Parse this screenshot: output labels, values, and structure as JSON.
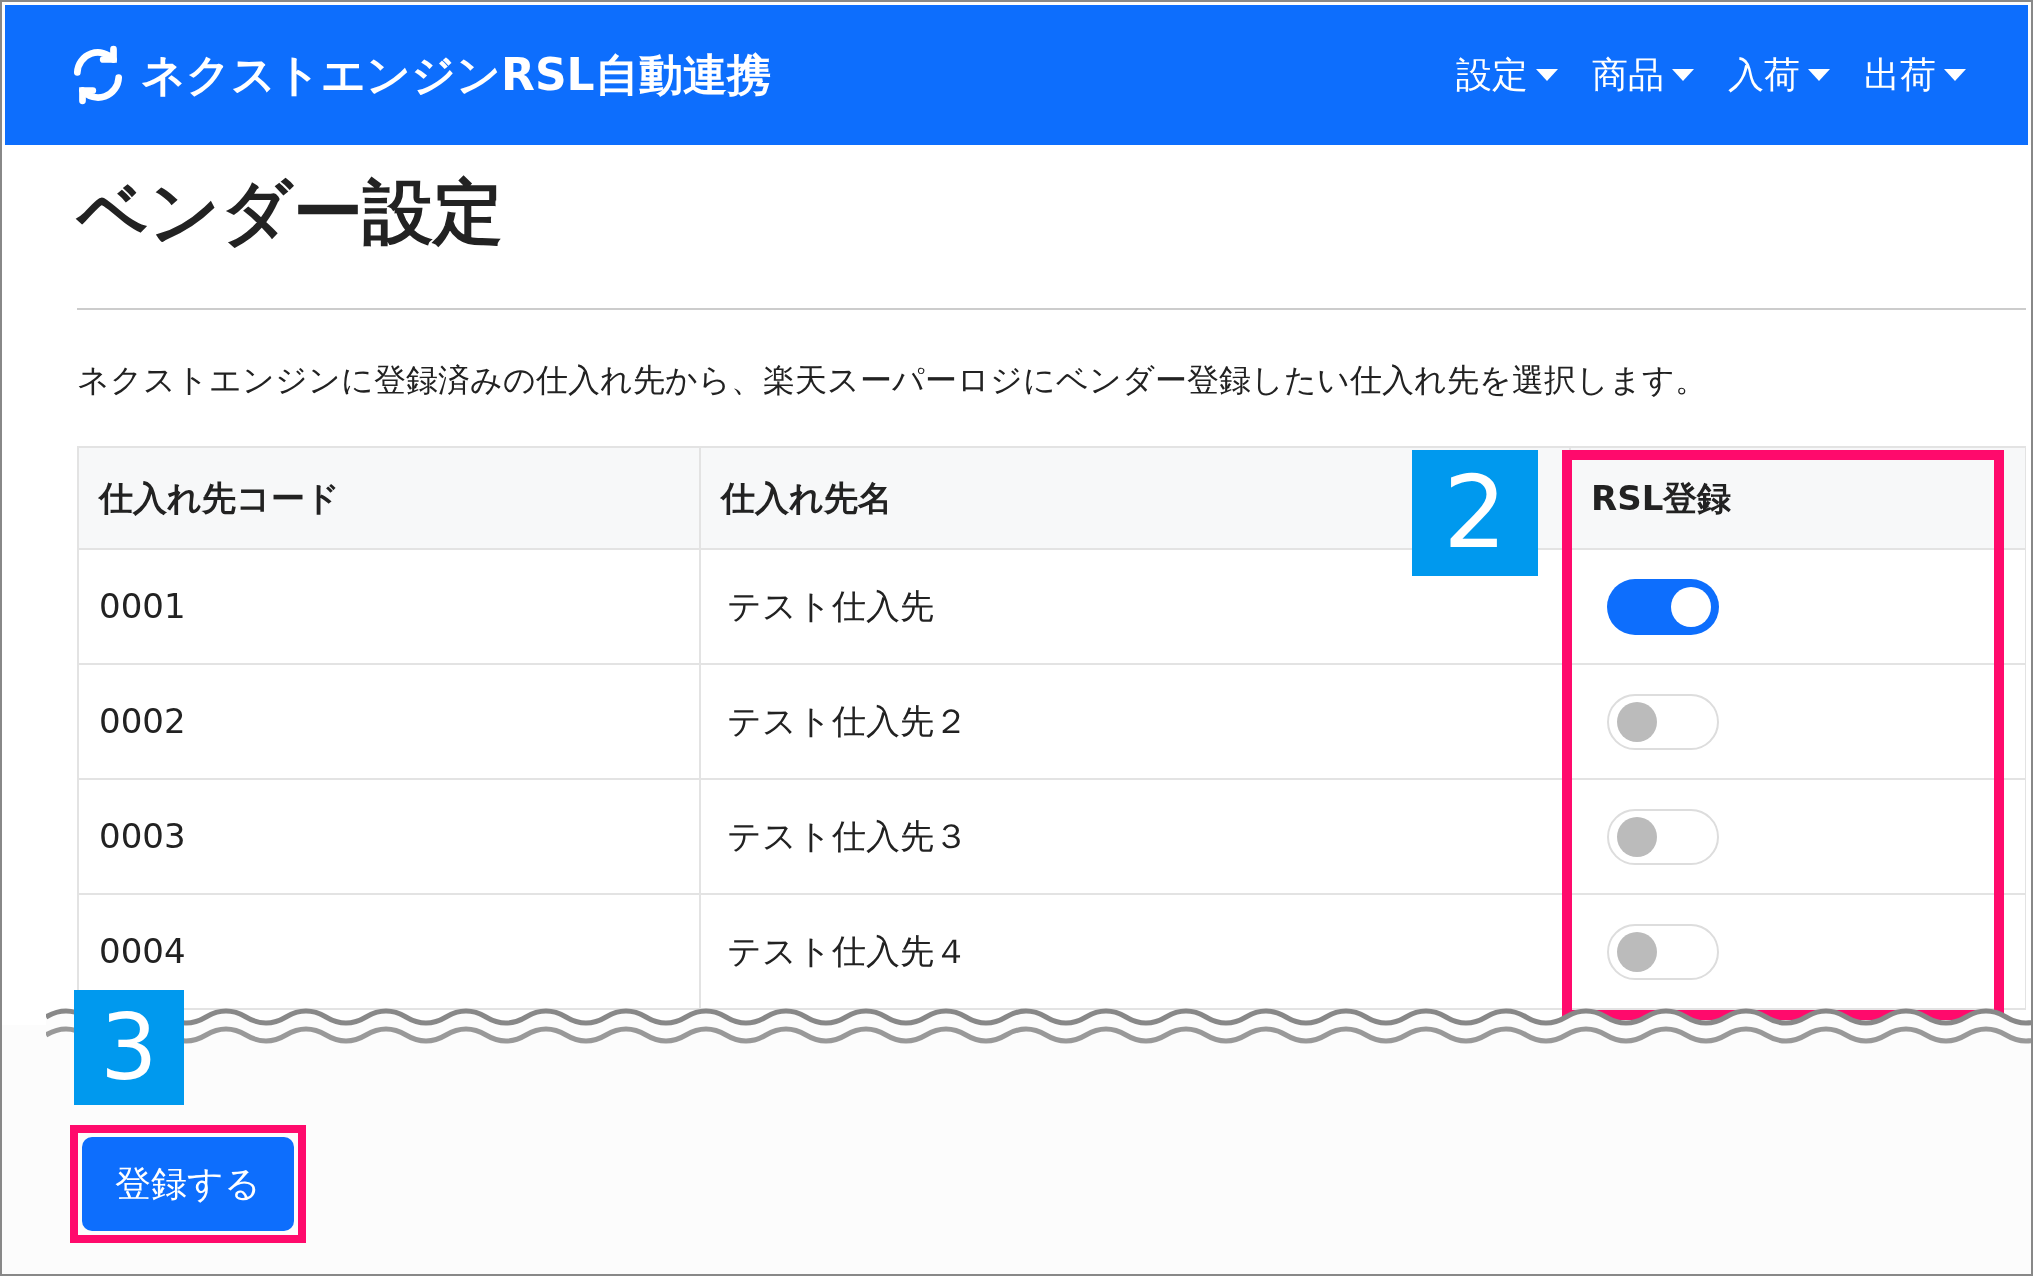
{
  "header": {
    "app_title": "ネクストエンジンRSL自動連携",
    "menus": [
      {
        "label": "設定"
      },
      {
        "label": "商品"
      },
      {
        "label": "入荷"
      },
      {
        "label": "出荷"
      }
    ]
  },
  "page_title": "ベンダー設定",
  "description": "ネクストエンジンに登録済みの仕入れ先から、楽天スーパーロジにベンダー登録したい仕入れ先を選択します。",
  "table": {
    "columns": [
      "仕入れ先コード",
      "仕入れ先名",
      "RSL登録"
    ],
    "rows": [
      {
        "code": "0001",
        "name": "テスト仕入先",
        "on": true
      },
      {
        "code": "0002",
        "name": "テスト仕入先２",
        "on": false
      },
      {
        "code": "0003",
        "name": "テスト仕入先３",
        "on": false
      },
      {
        "code": "0004",
        "name": "テスト仕入先４",
        "on": false
      }
    ]
  },
  "submit_button": "登録する",
  "annotations": [
    {
      "label": "2"
    },
    {
      "label": "3"
    }
  ]
}
